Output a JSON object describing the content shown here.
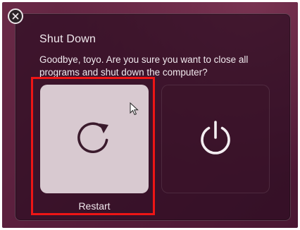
{
  "dialog": {
    "title": "Shut Down",
    "message": "Goodbye, toyo. Are you sure you want to close all programs and shut down the computer?",
    "close_icon": "close-icon"
  },
  "buttons": {
    "restart": {
      "label": "Restart",
      "icon": "restart-icon"
    },
    "shutdown": {
      "icon": "power-icon"
    }
  },
  "colors": {
    "background": "#5a1f3d",
    "restart_button_hover": "#d8c9d0",
    "text": "#f1e9ee",
    "highlight": "#ee1515"
  }
}
